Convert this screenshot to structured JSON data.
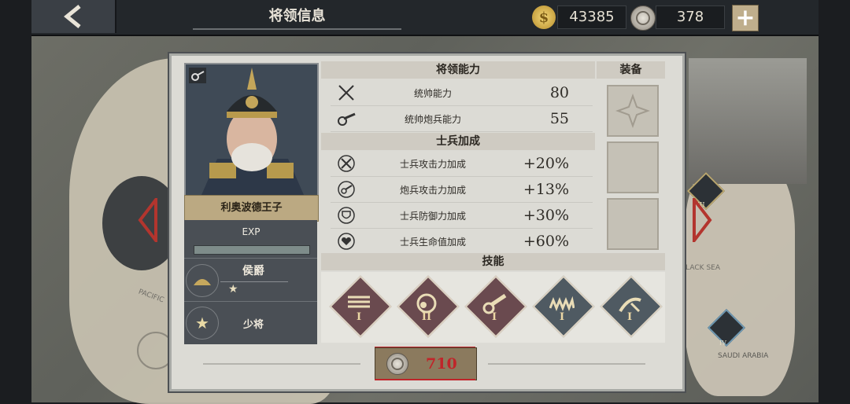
{
  "header": {
    "title": "将领信息",
    "gold": "43385",
    "medals": "378"
  },
  "general": {
    "name": "利奥波德王子",
    "exp_label": "EXP",
    "rank_title": "侯爵",
    "rank_stars": "★",
    "military_rank": "少将"
  },
  "abilities": {
    "heading": "将领能力",
    "rows": [
      {
        "label": "统帅能力",
        "value": "80"
      },
      {
        "label": "统帅炮兵能力",
        "value": "55"
      }
    ]
  },
  "bonuses": {
    "heading": "士兵加成",
    "rows": [
      {
        "label": "士兵攻击力加成",
        "value": "+20%"
      },
      {
        "label": "炮兵攻击力加成",
        "value": "+13%"
      },
      {
        "label": "士兵防御力加成",
        "value": "+30%"
      },
      {
        "label": "士兵生命值加成",
        "value": "+60%"
      }
    ]
  },
  "equipment": {
    "heading": "装备"
  },
  "skills": {
    "heading": "技能",
    "items": [
      {
        "tier": "I",
        "color": "#6a4a4f"
      },
      {
        "tier": "II",
        "color": "#6a4a4f"
      },
      {
        "tier": "I",
        "color": "#6a4a4f"
      },
      {
        "tier": "I",
        "color": "#4f5a62"
      },
      {
        "tier": "I",
        "color": "#4f5a62"
      }
    ]
  },
  "cost": {
    "value": "710"
  },
  "map": {
    "labels": [
      "BLACK SEA",
      "SAUDI ARABIA",
      "PACIFIC"
    ],
    "badges": [
      "III",
      "IV"
    ]
  },
  "colors": {
    "accent_red": "#c0252a",
    "gold": "#bba982"
  }
}
